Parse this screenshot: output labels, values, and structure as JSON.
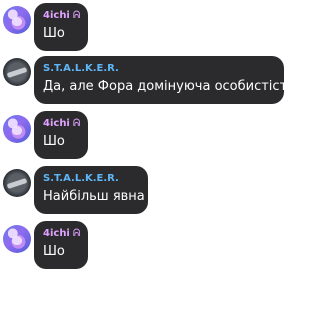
{
  "colors": {
    "user_pink": "#e0a2ff",
    "user_blue": "#5eb5f7",
    "bubble_bg": "#2b2b2d"
  },
  "messages": [
    {
      "author": "4ichi",
      "author_glyph": "ᕱ",
      "text": "Шо"
    },
    {
      "author": "S.T.A.L.K.E.R.",
      "author_glyph": "",
      "text": "Да, але Фора домінуюча особистість"
    },
    {
      "author": "4ichi",
      "author_glyph": "ᕱ",
      "text": "Шо"
    },
    {
      "author": "S.T.A.L.K.E.R.",
      "author_glyph": "",
      "text": "Найбільш явна"
    },
    {
      "author": "4ichi",
      "author_glyph": "ᕱ",
      "text": "Шо"
    }
  ]
}
